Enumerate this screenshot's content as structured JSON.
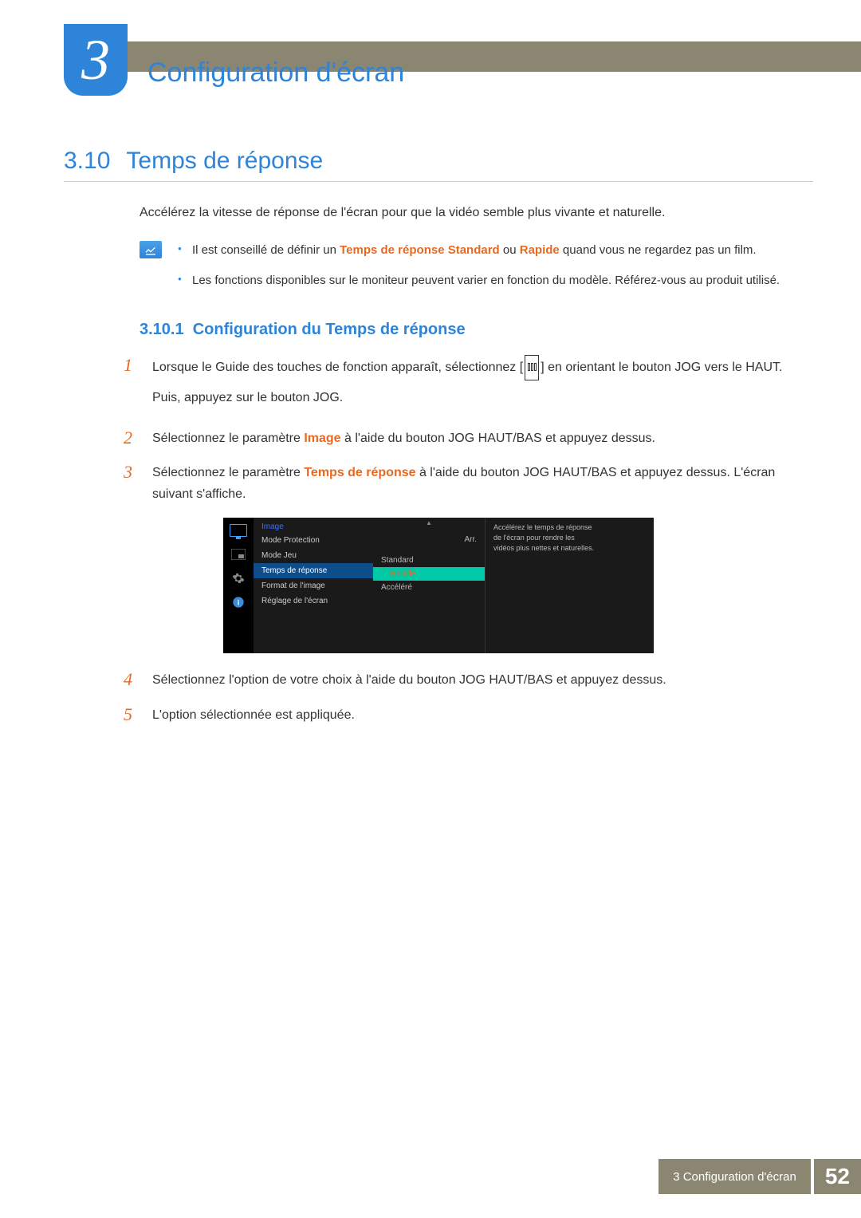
{
  "chapter": {
    "number": "3",
    "title": "Configuration d'écran"
  },
  "section": {
    "number": "3.10",
    "title": "Temps de réponse"
  },
  "intro": "Accélérez la vitesse de réponse de l'écran pour que la vidéo semble plus vivante et naturelle.",
  "notes": {
    "item1_prefix": "Il est conseillé de définir un ",
    "item1_bold1": "Temps de réponse Standard",
    "item1_mid": " ou ",
    "item1_bold2": "Rapide",
    "item1_suffix": " quand vous ne regardez pas un film.",
    "item2": "Les fonctions disponibles sur le moniteur peuvent varier en fonction du modèle. Référez-vous au produit utilisé."
  },
  "subsection": {
    "number": "3.10.1",
    "title": "Configuration du Temps de réponse"
  },
  "steps": {
    "s1a": "Lorsque le Guide des touches de fonction apparaît, sélectionnez [",
    "s1b": "] en orientant le bouton JOG vers le HAUT.",
    "s1c": "Puis, appuyez sur le bouton JOG.",
    "s2a": "Sélectionnez le paramètre ",
    "s2bold": "Image",
    "s2b": " à l'aide du bouton JOG HAUT/BAS et appuyez dessus.",
    "s3a": "Sélectionnez le paramètre ",
    "s3bold": "Temps de réponse",
    "s3b": " à l'aide du bouton JOG HAUT/BAS et appuyez dessus. L'écran suivant s'affiche.",
    "s4": "Sélectionnez l'option de votre choix à l'aide du bouton JOG HAUT/BAS et appuyez dessus.",
    "s5": "L'option sélectionnée est appliquée.",
    "n1": "1",
    "n2": "2",
    "n3": "3",
    "n4": "4",
    "n5": "5"
  },
  "osd": {
    "menu_title": "Image",
    "item1": "Mode Protection",
    "item2": "Mode Jeu",
    "item3": "Temps de réponse",
    "item4": "Format de l'image",
    "item5": "Réglage de l'écran",
    "val1": "Arr.",
    "opt1": "Standard",
    "opt2": "Rapide",
    "opt3": "Accéléré",
    "help": "Accélérez le temps de réponse de l'écran pour rendre les vidéos plus nettes et naturelles."
  },
  "footer": {
    "label": "3 Configuration d'écran",
    "page": "52"
  }
}
